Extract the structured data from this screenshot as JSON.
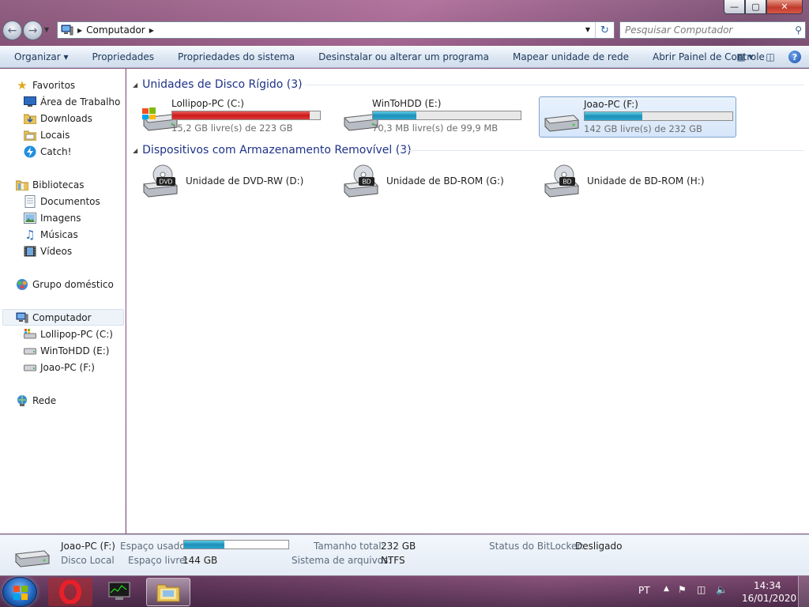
{
  "window": {
    "caption_buttons": {
      "minimize": "—",
      "maximize": "▢",
      "close": "✕"
    }
  },
  "address_bar": {
    "crumbs": [
      "Computador"
    ],
    "search_placeholder": "Pesquisar Computador"
  },
  "toolbar": {
    "items": [
      {
        "label": "Organizar ▾"
      },
      {
        "label": "Propriedades"
      },
      {
        "label": "Propriedades do sistema"
      },
      {
        "label": "Desinstalar ou alterar um programa"
      },
      {
        "label": "Mapear unidade de rede"
      },
      {
        "label": "Abrir Painel de Controle"
      }
    ],
    "help_label": "?"
  },
  "navpane": {
    "favorites": {
      "label": "Favoritos",
      "items": [
        "Área de Trabalho",
        "Downloads",
        "Locais",
        "Catch!"
      ]
    },
    "libraries": {
      "label": "Bibliotecas",
      "items": [
        "Documentos",
        "Imagens",
        "Músicas",
        "Vídeos"
      ]
    },
    "homegroup": {
      "label": "Grupo doméstico"
    },
    "computer": {
      "label": "Computador",
      "items": [
        "Lollipop-PC (C:)",
        "WinToHDD (E:)",
        "Joao-PC (F:)"
      ]
    },
    "network": {
      "label": "Rede"
    }
  },
  "content": {
    "hard_disks": {
      "header": "Unidades de Disco Rígido (3)",
      "drives": [
        {
          "name": "Lollipop-PC (C:)",
          "free_text": "15,2 GB livre(s) de 223 GB",
          "used_fraction": 0.932,
          "bar_color": "#cc1a1a"
        },
        {
          "name": "WinToHDD (E:)",
          "free_text": "70,3 MB livre(s) de 99,9 MB",
          "used_fraction": 0.296,
          "bar_color": "#1f8fb8"
        },
        {
          "name": "Joao-PC (F:)",
          "free_text": "142 GB livre(s) de 232 GB",
          "used_fraction": 0.388,
          "bar_color": "#1f8fb8"
        }
      ]
    },
    "removable": {
      "header": "Dispositivos com Armazenamento Removível (3)",
      "drives": [
        {
          "name": "Unidade de DVD-RW (D:)",
          "badge": "DVD"
        },
        {
          "name": "Unidade de BD-ROM (G:)",
          "badge": "BD"
        },
        {
          "name": "Unidade de BD-ROM (H:)",
          "badge": "BD"
        }
      ]
    }
  },
  "details": {
    "name": "Joao-PC (F:)",
    "type": "Disco Local",
    "used_label": "Espaço usado:",
    "used_fraction": 0.388,
    "free_label": "Espaço livre:",
    "free_value": "144 GB",
    "total_label": "Tamanho total:",
    "total_value": "232 GB",
    "fs_label": "Sistema de arquivos:",
    "fs_value": "NTFS",
    "bitlocker_label": "Status do BitLocker:",
    "bitlocker_value": "Desligado"
  },
  "taskbar": {
    "language": "PT",
    "time": "14:34",
    "date": "16/01/2020"
  }
}
